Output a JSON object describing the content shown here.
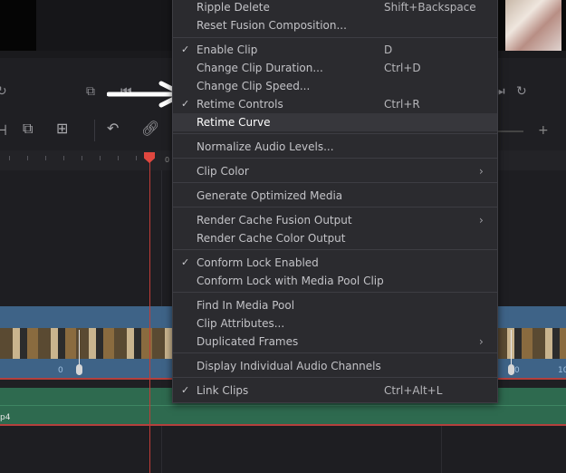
{
  "timeline": {
    "ruler_label": "0",
    "frame_numbers": [
      "0",
      "0",
      "10"
    ],
    "audio_clip_label": "p4"
  },
  "menu": {
    "items": [
      {
        "label": "Ripple Delete",
        "shortcut": "Shift+Backspace",
        "checked": false,
        "submenu": false
      },
      {
        "label": "Reset Fusion Composition...",
        "shortcut": "",
        "checked": false,
        "submenu": false
      },
      {
        "label": "Enable Clip",
        "shortcut": "D",
        "checked": true,
        "submenu": false
      },
      {
        "label": "Change Clip Duration...",
        "shortcut": "Ctrl+D",
        "checked": false,
        "submenu": false
      },
      {
        "label": "Change Clip Speed...",
        "shortcut": "",
        "checked": false,
        "submenu": false
      },
      {
        "label": "Retime Controls",
        "shortcut": "Ctrl+R",
        "checked": true,
        "submenu": false
      },
      {
        "label": "Retime Curve",
        "shortcut": "",
        "checked": false,
        "submenu": false,
        "highlighted": true
      },
      {
        "label": "Normalize Audio Levels...",
        "shortcut": "",
        "checked": false,
        "submenu": false
      },
      {
        "label": "Clip Color",
        "shortcut": "",
        "checked": false,
        "submenu": true
      },
      {
        "label": "Generate Optimized Media",
        "shortcut": "",
        "checked": false,
        "submenu": false
      },
      {
        "label": "Render Cache Fusion Output",
        "shortcut": "",
        "checked": false,
        "submenu": true
      },
      {
        "label": "Render Cache Color Output",
        "shortcut": "",
        "checked": false,
        "submenu": false
      },
      {
        "label": "Conform Lock Enabled",
        "shortcut": "",
        "checked": true,
        "submenu": false
      },
      {
        "label": "Conform Lock with Media Pool Clip",
        "shortcut": "",
        "checked": false,
        "submenu": false
      },
      {
        "label": "Find In Media Pool",
        "shortcut": "",
        "checked": false,
        "submenu": false
      },
      {
        "label": "Clip Attributes...",
        "shortcut": "",
        "checked": false,
        "submenu": false
      },
      {
        "label": "Duplicated Frames",
        "shortcut": "",
        "checked": false,
        "submenu": true
      },
      {
        "label": "Display Individual Audio Channels",
        "shortcut": "",
        "checked": false,
        "submenu": false
      },
      {
        "label": "Link Clips",
        "shortcut": "Ctrl+Alt+L",
        "checked": true,
        "submenu": false
      }
    ],
    "checkmark_glyph": "✓",
    "submenu_glyph": "›"
  },
  "icons": {
    "annotation": "right-arrow-icon",
    "transport": [
      "loop-icon",
      "clip-icon",
      "prev-frame-icon",
      "next-frame-icon",
      "loop-icon"
    ],
    "toolbar": [
      "razor-tool-icon",
      "insert-clip-icon",
      "overwrite-clip-icon",
      "snapping-icon",
      "link-icon",
      "zoom-in-icon"
    ]
  },
  "colors": {
    "menu_bg": "#2b2b2f",
    "highlight_bg": "#37373c",
    "video_clip": "#3e6387",
    "audio_clip": "#2e6a4f",
    "playhead": "#e0473f"
  }
}
